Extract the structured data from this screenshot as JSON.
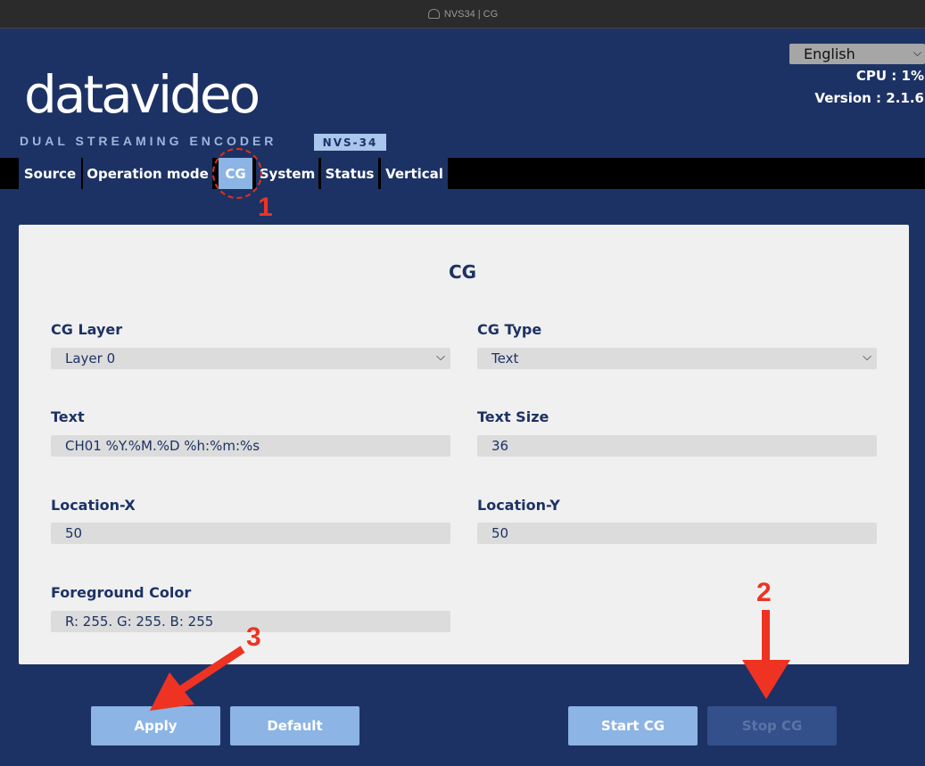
{
  "window": {
    "title": "NVS34 | CG"
  },
  "header": {
    "language": "English",
    "cpu": "CPU : 1%",
    "version": "Version : 2.1.6",
    "logo_text": "datavideo",
    "subtitle": "DUAL STREAMING ENCODER",
    "model": "NVS-34"
  },
  "tabs": [
    {
      "label": "Source"
    },
    {
      "label": "Operation mode"
    },
    {
      "label": "CG",
      "active": true
    },
    {
      "label": "System"
    },
    {
      "label": "Status"
    },
    {
      "label": "Vertical"
    }
  ],
  "panel": {
    "title": "CG",
    "cg_layer": {
      "label": "CG Layer",
      "value": "Layer 0"
    },
    "cg_type": {
      "label": "CG Type",
      "value": "Text"
    },
    "text": {
      "label": "Text",
      "value": "CH01 %Y.%M.%D %h:%m:%s"
    },
    "text_size": {
      "label": "Text Size",
      "value": "36"
    },
    "location_x": {
      "label": "Location-X",
      "value": "50"
    },
    "location_y": {
      "label": "Location-Y",
      "value": "50"
    },
    "foreground_color": {
      "label": "Foreground Color",
      "value": "R: 255. G: 255. B: 255"
    }
  },
  "buttons": {
    "apply": "Apply",
    "default": "Default",
    "start_cg": "Start CG",
    "stop_cg": "Stop CG"
  },
  "annotations": {
    "n1": "1",
    "n2": "2",
    "n3": "3"
  },
  "colors": {
    "background": "#1d3264",
    "accent": "#8cb4e4",
    "annotation": "#ee3322"
  }
}
